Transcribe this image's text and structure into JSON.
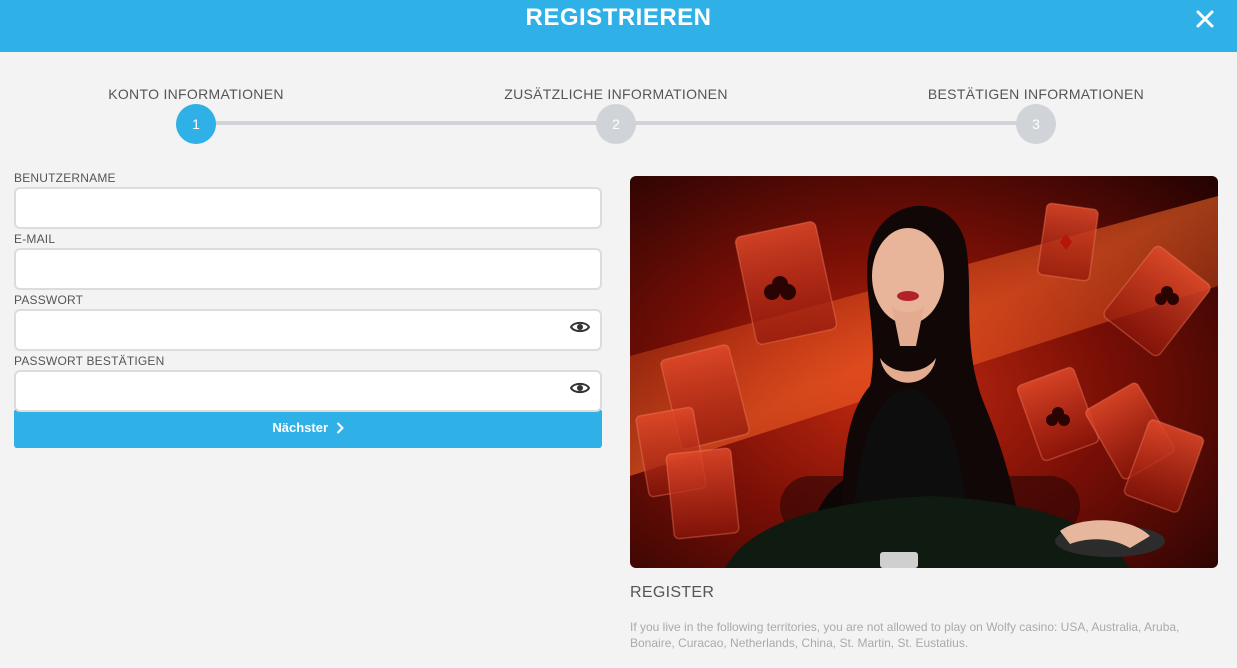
{
  "header": {
    "title": "REGISTRIEREN",
    "close_icon": "close-icon"
  },
  "colors": {
    "accent": "#2fb0e6",
    "inactive_step": "#d0d3d8",
    "background": "#f3f3f3"
  },
  "stepper": {
    "current_step": 1,
    "steps": [
      {
        "label": "KONTO INFORMATIONEN",
        "number": "1"
      },
      {
        "label": "ZUSÄTZLICHE INFORMATIONEN",
        "number": "2"
      },
      {
        "label": "BESTÄTIGEN INFORMATIONEN",
        "number": "3"
      }
    ]
  },
  "form": {
    "username": {
      "label": "BENUTZERNAME",
      "value": ""
    },
    "email": {
      "label": "E-MAIL",
      "value": ""
    },
    "password": {
      "label": "PASSWORT",
      "value": "",
      "icon": "eye-icon"
    },
    "password_confirm": {
      "label": "PASSWORT BESTÄTIGEN",
      "value": "",
      "icon": "eye-icon"
    },
    "next_label": "Nächster",
    "next_icon": "chevron-right-icon"
  },
  "promo": {
    "image": "live-dealer-casino-image",
    "title": "REGISTER",
    "text": "If you live in the following territories, you are not allowed to play on Wolfy casino: USA, Australia, Aruba, Bonaire, Curacao, Netherlands, China, St. Martin, St. Eustatius."
  }
}
